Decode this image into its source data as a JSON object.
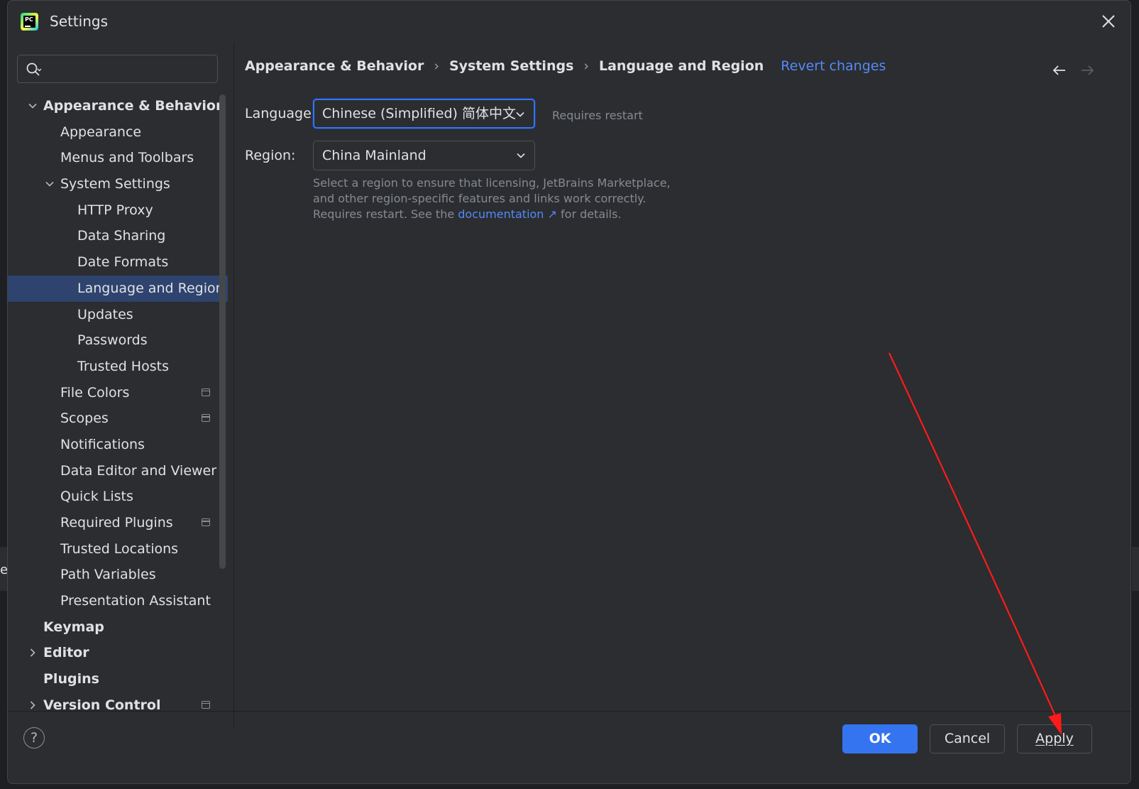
{
  "window": {
    "title": "Settings",
    "app_icon": "pycharm-logo",
    "close_icon": "close-icon"
  },
  "background": {
    "partial_text": "e"
  },
  "search": {
    "value": "",
    "placeholder": "",
    "icon": "search-icon"
  },
  "sidebar": {
    "items": [
      {
        "label": "Appearance & Behavior",
        "level": 0,
        "bold": true,
        "expanded": true,
        "chevron": "down"
      },
      {
        "label": "Appearance",
        "level": 1
      },
      {
        "label": "Menus and Toolbars",
        "level": 1
      },
      {
        "label": "System Settings",
        "level": 1,
        "expanded": true,
        "chevron": "down"
      },
      {
        "label": "HTTP Proxy",
        "level": 2
      },
      {
        "label": "Data Sharing",
        "level": 2
      },
      {
        "label": "Date Formats",
        "level": 2
      },
      {
        "label": "Language and Region",
        "level": 2,
        "selected": true
      },
      {
        "label": "Updates",
        "level": 2
      },
      {
        "label": "Passwords",
        "level": 2
      },
      {
        "label": "Trusted Hosts",
        "level": 2
      },
      {
        "label": "File Colors",
        "level": 1,
        "project_icon": true
      },
      {
        "label": "Scopes",
        "level": 1,
        "project_icon": true
      },
      {
        "label": "Notifications",
        "level": 1
      },
      {
        "label": "Data Editor and Viewer",
        "level": 1
      },
      {
        "label": "Quick Lists",
        "level": 1
      },
      {
        "label": "Required Plugins",
        "level": 1,
        "project_icon": true
      },
      {
        "label": "Trusted Locations",
        "level": 1
      },
      {
        "label": "Path Variables",
        "level": 1
      },
      {
        "label": "Presentation Assistant",
        "level": 1
      },
      {
        "label": "Keymap",
        "level": 0,
        "bold": true
      },
      {
        "label": "Editor",
        "level": 0,
        "bold": true,
        "chevron": "right"
      },
      {
        "label": "Plugins",
        "level": 0,
        "bold": true
      },
      {
        "label": "Version Control",
        "level": 0,
        "bold": true,
        "chevron": "right",
        "project_icon": true
      }
    ]
  },
  "breadcrumb": {
    "items": [
      "Appearance & Behavior",
      "System Settings",
      "Language and Region"
    ],
    "separator": "›",
    "revert_label": "Revert changes"
  },
  "form": {
    "language_label": "Language:",
    "language_value": "Chinese (Simplified) 简体中文",
    "language_hint": "Requires restart",
    "region_label": "Region:",
    "region_value": "China Mainland",
    "help_text_1": "Select a region to ensure that licensing, JetBrains Marketplace, and other region-specific features and links work correctly. Requires restart. See the",
    "help_link": "documentation ↗",
    "help_text_2": "for details."
  },
  "footer": {
    "help": "?",
    "ok": "OK",
    "cancel": "Cancel",
    "apply": "Apply"
  },
  "colors": {
    "accent": "#3574f0",
    "link": "#548af7",
    "selection": "#2e436e",
    "annotation_arrow": "#ff1a1a"
  }
}
